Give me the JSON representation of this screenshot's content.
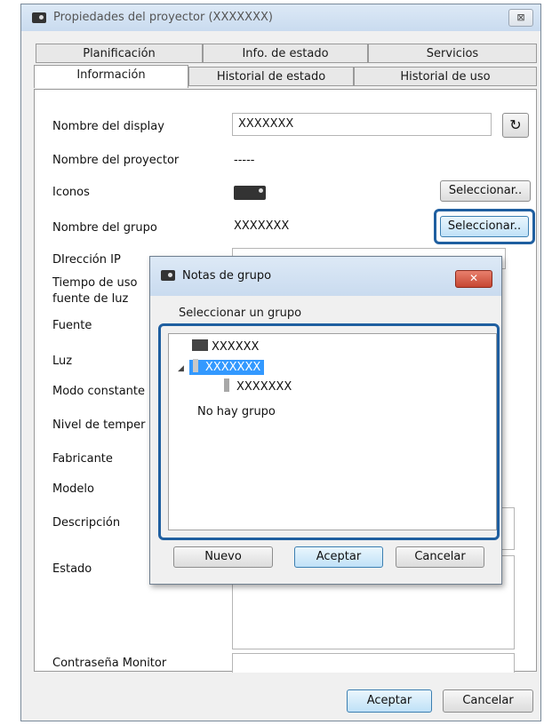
{
  "window": {
    "title": "Propiedades del proyector (XXXXXXX)",
    "close_label": "⊠"
  },
  "tabs_back": [
    "Planificación",
    "Info. de estado",
    "Servicios"
  ],
  "tabs_front": [
    "Información",
    "Historial de estado",
    "Historial de uso"
  ],
  "form": {
    "display_name_label": "Nombre del display",
    "display_name_value": "XXXXXXX",
    "refresh_icon": "↻",
    "projector_name_label": "Nombre del proyector",
    "projector_name_value": "-----",
    "icons_label": "Iconos",
    "select_label": "Seleccionar..",
    "group_name_label": "Nombre del grupo",
    "group_name_value": "XXXXXXX",
    "ip_label": "DIrección IP",
    "usage_time_label_1": "Tiempo de uso",
    "usage_time_label_2": "fuente de luz",
    "source_label": "Fuente",
    "light_label": "Luz",
    "constant_mode_label": "Modo constante",
    "temp_level_label": "Nivel de temper",
    "manufacturer_label": "Fabricante",
    "model_label": "Modelo",
    "description_label": "Descripción",
    "status_label": "Estado",
    "monitor_password_label": "Contraseña Monitor"
  },
  "footer": {
    "accept": "Aceptar",
    "cancel": "Cancelar"
  },
  "dialog": {
    "title": "Notas de grupo",
    "close_icon": "✕",
    "prompt": "Seleccionar un grupo",
    "tree": [
      {
        "label": "XXXXXX"
      },
      {
        "label": "XXXXXXX",
        "selected": true
      },
      {
        "label": "XXXXXXX"
      },
      {
        "label": "No hay grupo"
      }
    ],
    "buttons": {
      "new": "Nuevo",
      "accept": "Aceptar",
      "cancel": "Cancelar"
    }
  }
}
